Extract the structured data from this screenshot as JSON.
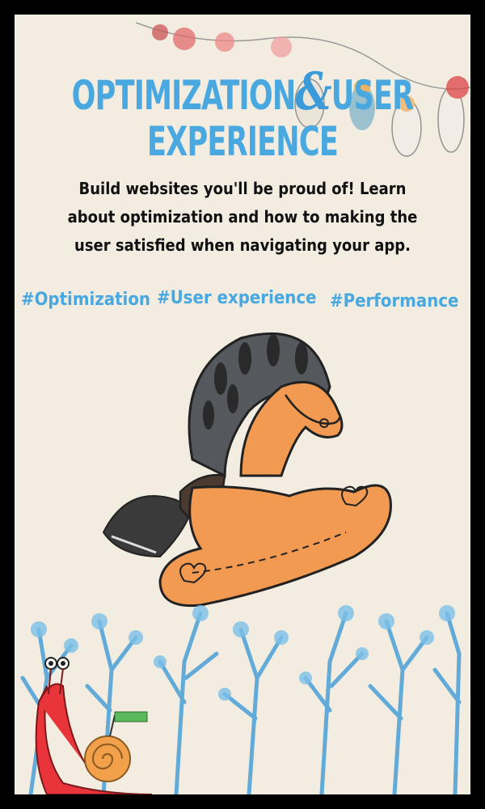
{
  "title": {
    "line1_a": "OPTIMIZATION",
    "amp": "&",
    "line1_b": "USER",
    "line2": "EXPERIENCE"
  },
  "description": "Build websites you'll be proud of! Learn about optimization and how to making the user satisfied when navigating your app.",
  "tags": [
    "#Optimization",
    "#User experience",
    "#Performance"
  ],
  "colors": {
    "background": "#f2ece1",
    "accent": "#49a8e0",
    "frame": "#000000",
    "horse": "#f29a52",
    "text": "#111111"
  },
  "illustrations": [
    "rocking-horse",
    "hanging-ornaments",
    "blue-foliage",
    "snail"
  ]
}
